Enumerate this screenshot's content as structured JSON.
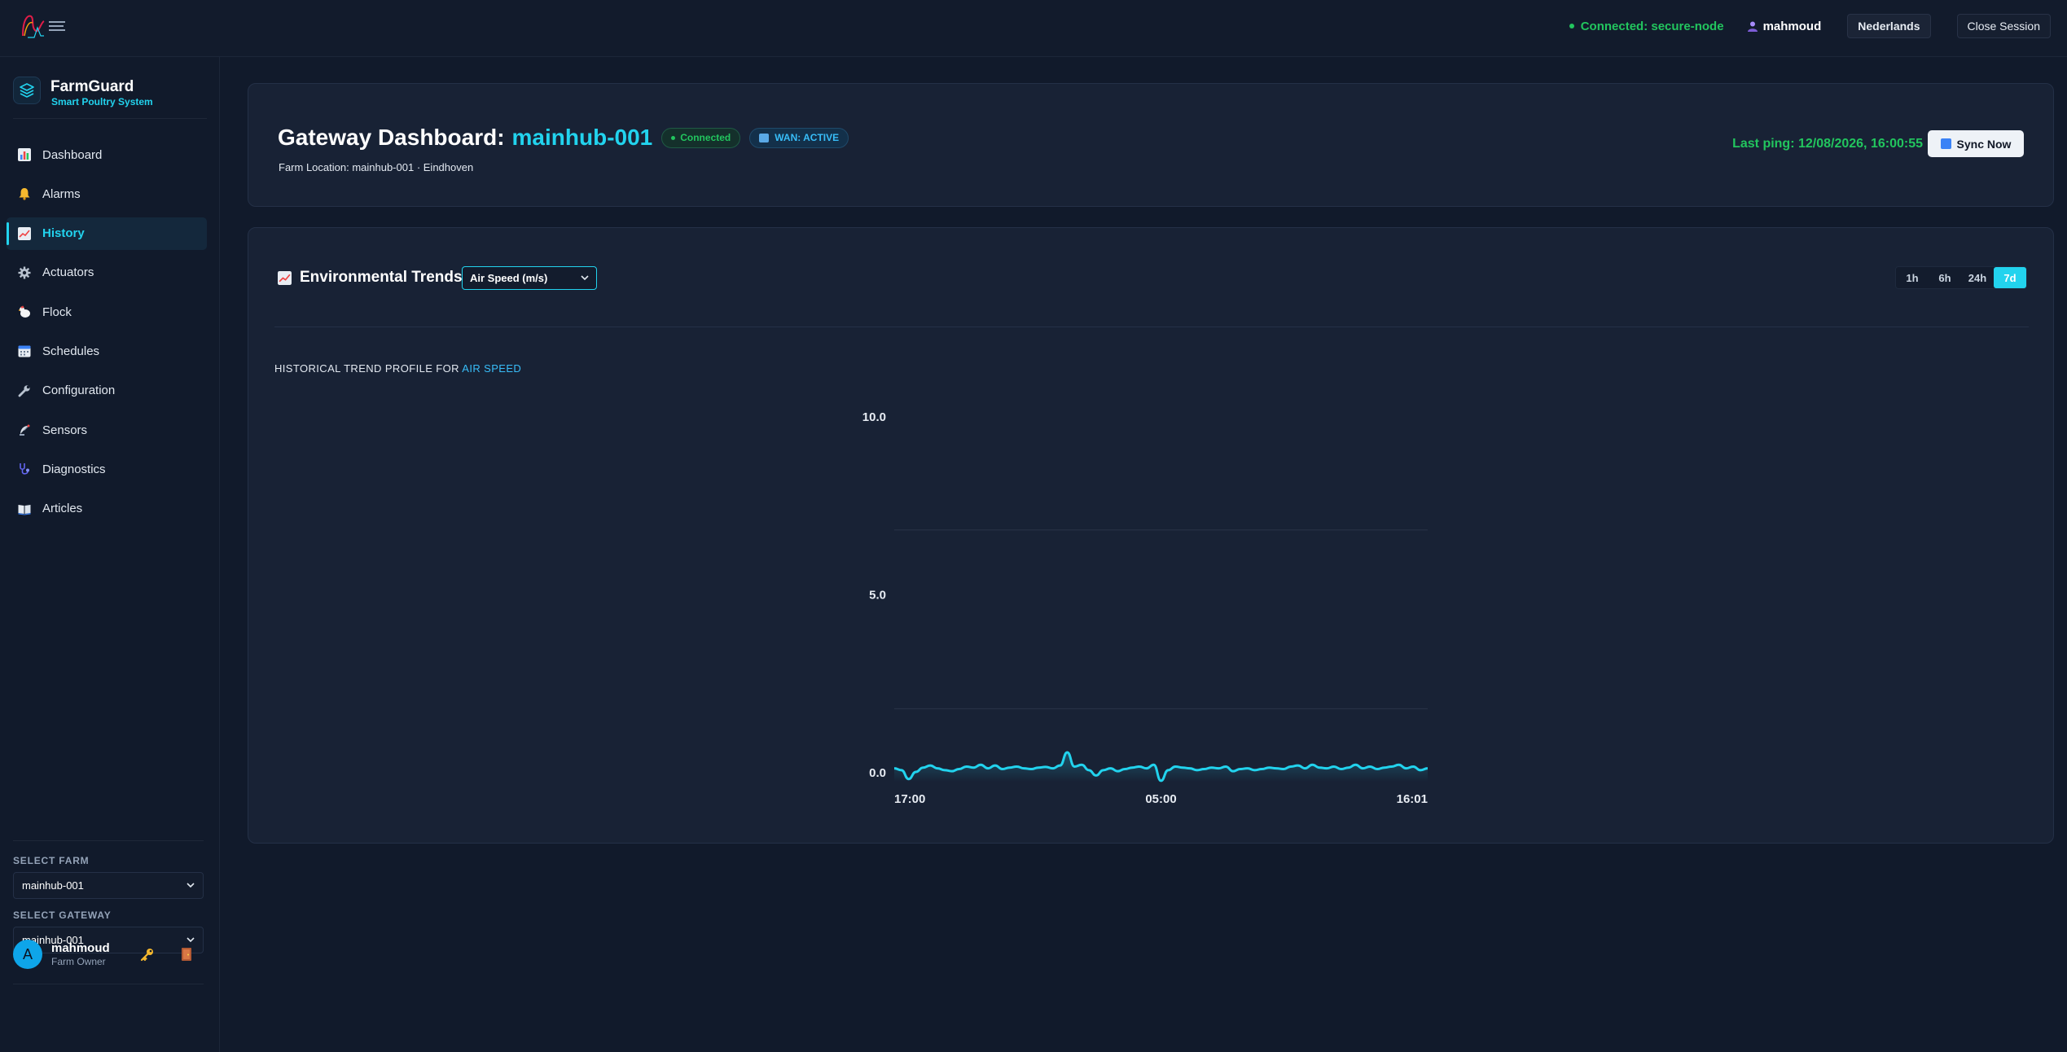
{
  "topbar": {
    "connection": "Connected: secure-node",
    "username": "mahmoud",
    "language": "Nederlands",
    "close_session": "Close Session"
  },
  "brand": {
    "name": "FarmGuard",
    "tagline": "Smart Poultry System"
  },
  "sidebar": {
    "items": [
      {
        "label": "Dashboard",
        "icon": "bar-chart-icon",
        "active": false
      },
      {
        "label": "Alarms",
        "icon": "bell-icon",
        "active": false
      },
      {
        "label": "History",
        "icon": "chart-up-icon",
        "active": true
      },
      {
        "label": "Actuators",
        "icon": "gear-icon",
        "active": false
      },
      {
        "label": "Flock",
        "icon": "chicken-icon",
        "active": false
      },
      {
        "label": "Schedules",
        "icon": "calendar-icon",
        "active": false
      },
      {
        "label": "Configuration",
        "icon": "wrench-icon",
        "active": false
      },
      {
        "label": "Sensors",
        "icon": "satellite-icon",
        "active": false
      },
      {
        "label": "Diagnostics",
        "icon": "stethoscope-icon",
        "active": false
      },
      {
        "label": "Articles",
        "icon": "book-icon",
        "active": false
      }
    ],
    "select_farm_label": "SELECT FARM",
    "select_farm_value": "mainhub-001",
    "select_gateway_label": "SELECT GATEWAY",
    "select_gateway_value": "mainhub-001",
    "profile": {
      "initial": "A",
      "name": "mahmoud",
      "role": "Farm Owner"
    }
  },
  "gateway": {
    "title_prefix": "Gateway Dashboard:",
    "id": "mainhub-001",
    "status_badge": "Connected",
    "wan_badge": "WAN: ACTIVE",
    "location": "Farm Location: mainhub-001 · Eindhoven",
    "last_ping": "Last ping: 12/08/2026, 16:00:55",
    "sync_label": "Sync Now"
  },
  "trends": {
    "title": "Environmental Trends",
    "metric": "Air Speed (m/s)",
    "ranges": [
      "1h",
      "6h",
      "24h",
      "7d"
    ],
    "active_range": "7d",
    "profile_prefix": "HISTORICAL TREND PROFILE FOR",
    "profile_metric": "AIR SPEED"
  },
  "chart_data": {
    "type": "line",
    "title": "",
    "xlabel": "",
    "ylabel": "",
    "x_tick_labels": [
      "17:00",
      "05:00",
      "16:01"
    ],
    "y_tick_labels": [
      "10.0",
      "5.0",
      "0.0"
    ],
    "ylim": [
      0,
      10
    ],
    "grid": true,
    "color": "#22d3ee",
    "series": [
      {
        "values": [
          0.1,
          0.05,
          -0.2,
          0.0,
          0.12,
          0.18,
          0.1,
          0.05,
          0.02,
          0.08,
          0.15,
          0.12,
          0.2,
          0.1,
          0.18,
          0.08,
          0.12,
          0.15,
          0.1,
          0.08,
          0.12,
          0.14,
          0.1,
          0.18,
          0.55,
          0.15,
          0.2,
          0.05,
          -0.1,
          0.05,
          0.1,
          0.02,
          0.08,
          0.12,
          0.15,
          0.1,
          0.2,
          -0.25,
          0.05,
          0.15,
          0.12,
          0.1,
          0.05,
          0.08,
          0.12,
          0.1,
          0.15,
          0.02,
          0.08,
          0.1,
          0.05,
          0.08,
          0.12,
          0.1,
          0.08,
          0.15,
          0.18,
          0.1,
          0.2,
          0.12,
          0.1,
          0.15,
          0.08,
          0.12,
          0.2,
          0.1,
          0.15,
          0.08,
          0.12,
          0.15,
          0.2,
          0.1,
          0.15,
          0.05,
          0.1
        ]
      }
    ]
  }
}
